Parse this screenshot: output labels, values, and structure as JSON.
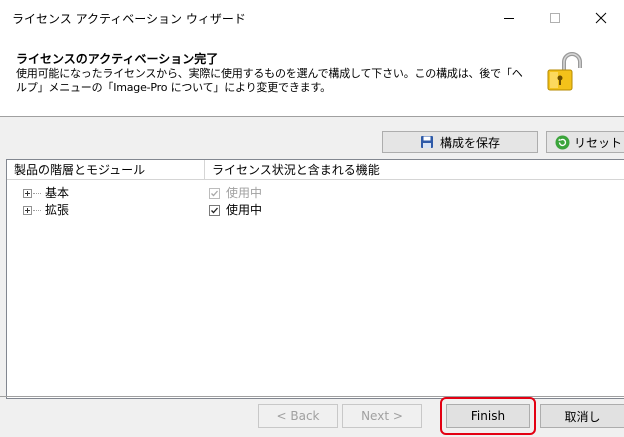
{
  "window": {
    "title": "ライセンス アクティベーション ウィザード",
    "minimize_icon": "minimize-icon",
    "maximize_icon": "maximize-icon",
    "close_icon": "close-icon"
  },
  "header": {
    "title": "ライセンスのアクティベーション完了",
    "description": "使用可能になったライセンスから、実際に使用するものを選んで構成して下さい。この構成は、後で「ヘルプ」メニューの「Image-Pro について」により変更できます。",
    "icon": "padlock-open-icon"
  },
  "toolbar": {
    "save_label": "構成を保存",
    "save_icon": "save-disk-icon",
    "reset_label": "リセット",
    "reset_icon": "refresh-icon"
  },
  "tree": {
    "columns": [
      "製品の階層とモジュール",
      "ライセンス状況と含まれる機能"
    ],
    "rows": [
      {
        "name": "基本",
        "status": "使用中",
        "checked": true,
        "enabled": false
      },
      {
        "name": "拡張",
        "status": "使用中",
        "checked": true,
        "enabled": true
      }
    ]
  },
  "footer": {
    "back_label": "< Back",
    "next_label": "Next >",
    "finish_label": "Finish",
    "cancel_label": "取消し",
    "highlight_color": "#e30012"
  }
}
